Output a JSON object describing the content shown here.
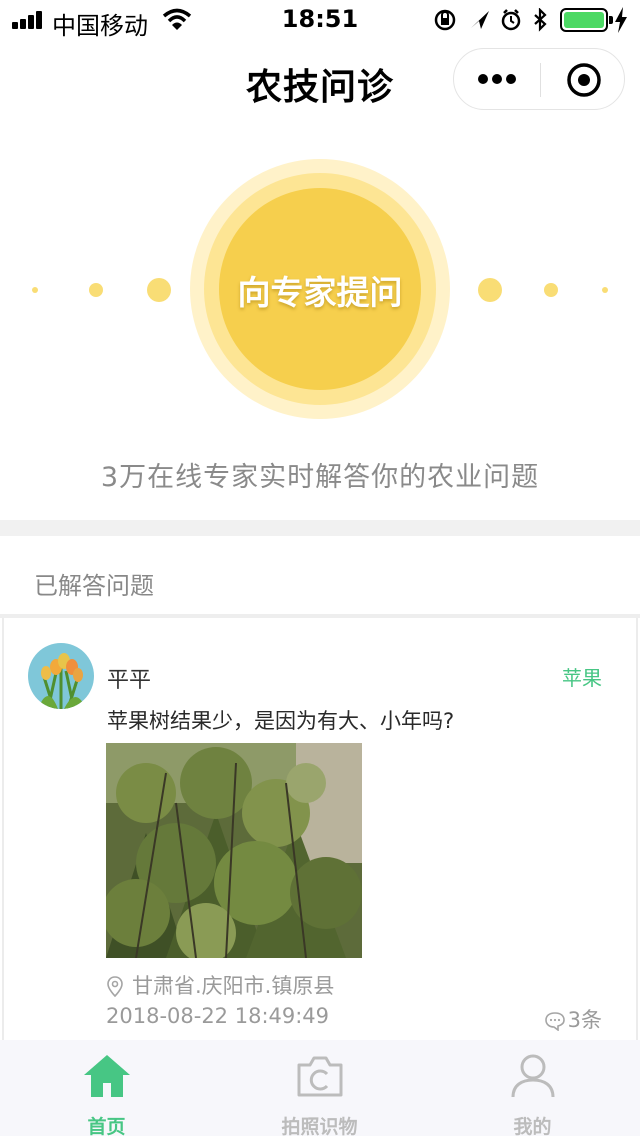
{
  "status_bar": {
    "carrier": "中国移动",
    "time": "18:51"
  },
  "nav": {
    "title": "农技问诊"
  },
  "hero": {
    "ask_button": "向专家提问",
    "subtitle": "3万在线专家实时解答你的农业问题"
  },
  "section": {
    "title": "已解答问题"
  },
  "post": {
    "username": "平平",
    "crop_tag": "苹果",
    "question": "苹果树结果少，是因为有大、小年吗?",
    "location": "甘肃省.庆阳市.镇原县",
    "datetime": "2018-08-22 18:49:49",
    "replies": "3条"
  },
  "tabbar": {
    "items": [
      {
        "label": "首页",
        "icon": "home-icon",
        "active": true
      },
      {
        "label": "拍照识物",
        "icon": "camera-icon",
        "active": false
      },
      {
        "label": "我的",
        "icon": "user-icon",
        "active": false
      }
    ]
  },
  "colors": {
    "accent_green": "#47c684",
    "ask_yellow": "#f6cf4d",
    "inactive_tab": "#bcbcbc"
  }
}
